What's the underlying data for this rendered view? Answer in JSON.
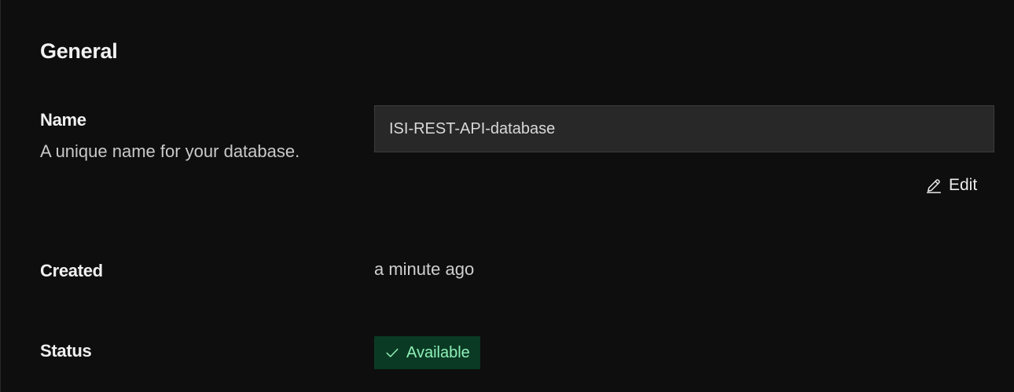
{
  "general": {
    "title": "General"
  },
  "name_field": {
    "label": "Name",
    "description": "A unique name for your database.",
    "value": "ISI-REST-API-database",
    "edit_label": "Edit"
  },
  "created_field": {
    "label": "Created",
    "value": "a minute ago"
  },
  "status_field": {
    "label": "Status",
    "value": "Available",
    "icon": "check-icon",
    "colors": {
      "badge_bg": "#0a3a24",
      "badge_text": "#8ff0b8"
    }
  },
  "icons": {
    "edit": "pencil-icon"
  }
}
